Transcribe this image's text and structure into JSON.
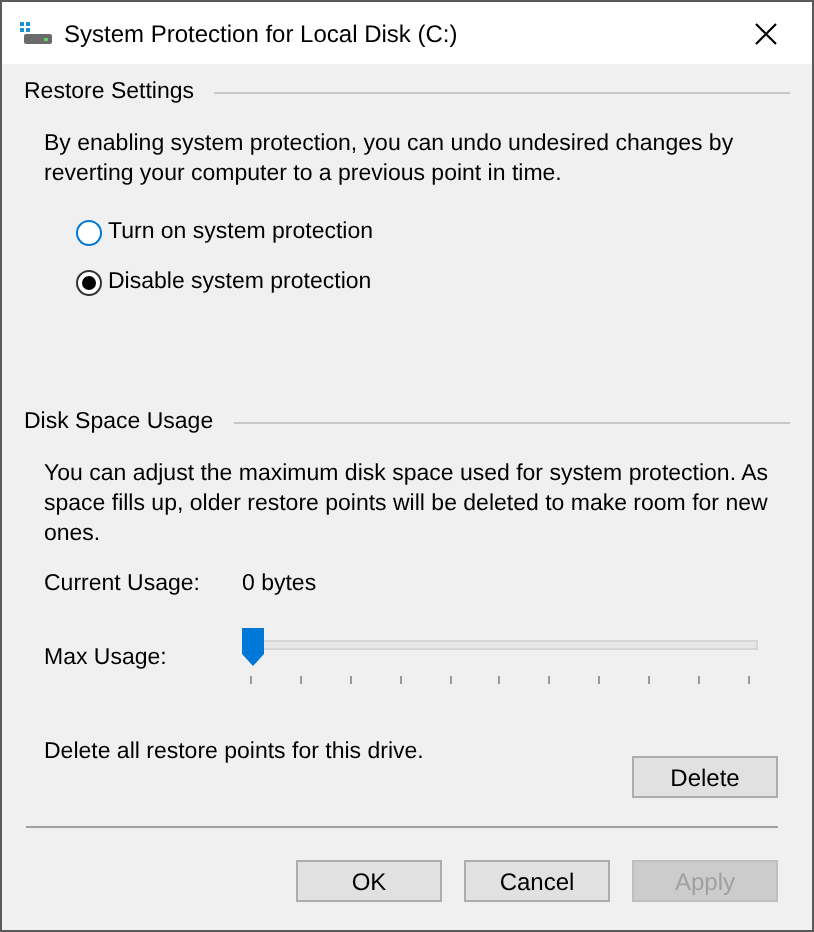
{
  "window": {
    "title": "System Protection for Local Disk (C:)"
  },
  "restore_settings": {
    "heading": "Restore Settings",
    "description": "By enabling system protection, you can undo undesired changes by reverting your computer to a previous point in time.",
    "options": [
      {
        "label": "Turn on system protection",
        "selected": false
      },
      {
        "label": "Disable system protection",
        "selected": true
      }
    ]
  },
  "disk_space_usage": {
    "heading": "Disk Space Usage",
    "description": "You can adjust the maximum disk space used for system protection. As space fills up, older restore points will be deleted to make room for new ones.",
    "current_usage_label": "Current Usage:",
    "current_usage_value": "0 bytes",
    "max_usage_label": "Max Usage:",
    "max_usage": {
      "level": 0
    },
    "delete_text": "Delete all restore points for this drive.",
    "delete_button": "Delete"
  },
  "buttons": [
    {
      "label": "OK",
      "disabled": false
    },
    {
      "label": "Cancel",
      "disabled": false
    },
    {
      "label": "Apply",
      "disabled": true
    }
  ]
}
